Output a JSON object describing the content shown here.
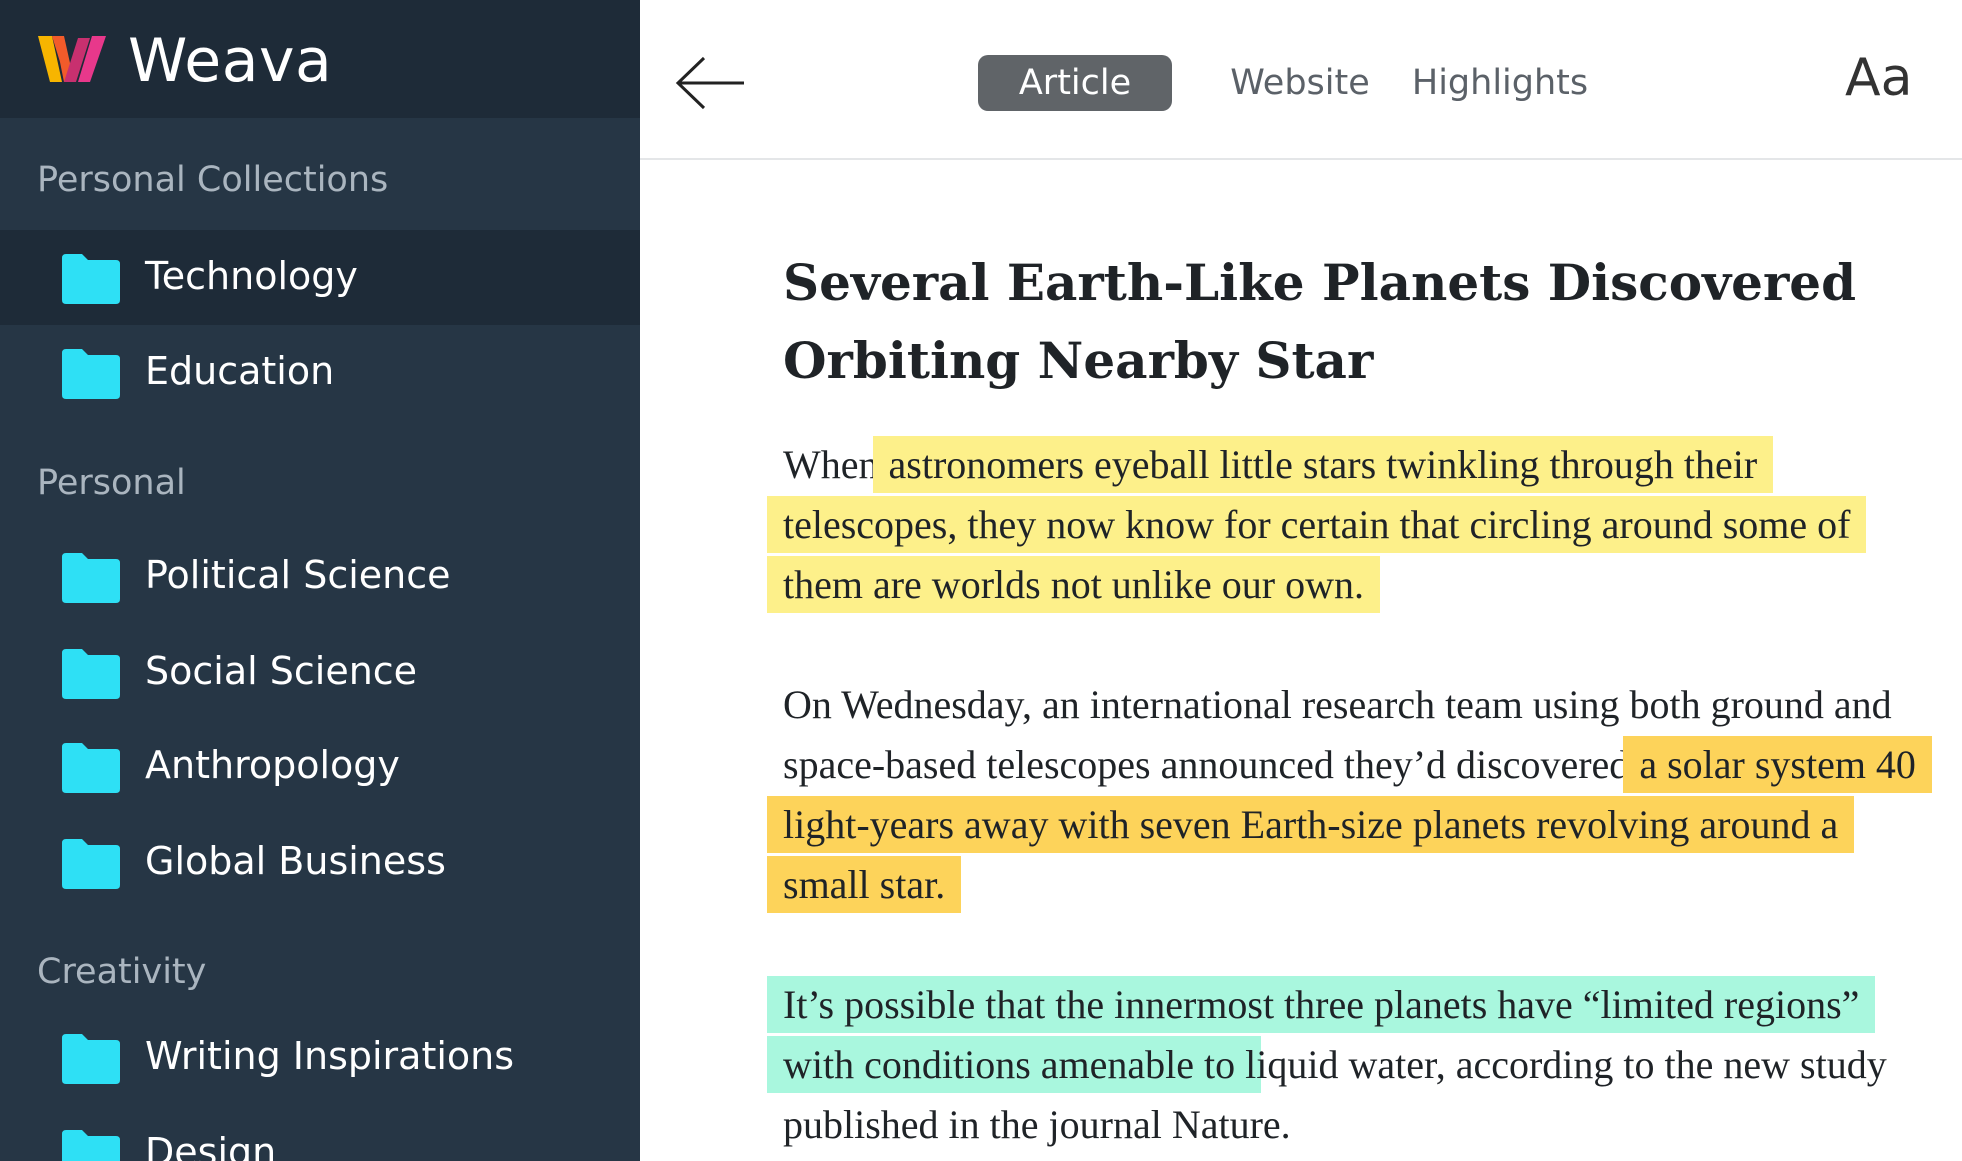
{
  "app": {
    "name": "Weava"
  },
  "sidebar": {
    "sections": [
      {
        "title": "Personal Collections",
        "items": [
          {
            "label": "Technology"
          },
          {
            "label": "Education"
          }
        ]
      },
      {
        "title": "Personal",
        "items": [
          {
            "label": "Political Science"
          },
          {
            "label": "Social Science"
          },
          {
            "label": "Anthropology"
          },
          {
            "label": "Global Business"
          }
        ]
      },
      {
        "title": "Creativity",
        "items": [
          {
            "label": "Writing Inspirations"
          },
          {
            "label": "Design"
          }
        ]
      }
    ],
    "active_item": "Technology"
  },
  "toolbar": {
    "tabs": [
      {
        "label": "Article"
      },
      {
        "label": "Website"
      },
      {
        "label": "Highlights"
      }
    ],
    "active_tab": "Article",
    "font_button": "Aa"
  },
  "article": {
    "title": "Several Earth-Like Planets Discovered Orbiting Nearby Star",
    "p1": {
      "before": "When ",
      "highlight": "astronomers eyeball little stars twinkling through their telescopes, they now know for certain that circling around some of them are worlds not unlike our own."
    },
    "p2": {
      "before": "On Wednesday, an international research team using both ground and space-based telescopes announced they’d discovered ",
      "highlight": "a solar system 40 light-years away with seven Earth-size planets revolving around a small star."
    },
    "p3": {
      "highlight": "It’s possible that the innermost three planets have “limited regions” with conditions amenable to ",
      "after": "liquid water, according to the new study published in the journal Nature."
    }
  },
  "colors": {
    "sidebar_bg": "#263645",
    "sidebar_header_bg": "#1e2b38",
    "folder": "#2ee0f5",
    "highlight_yellow": "#fdf08a",
    "highlight_orange": "#fdd35a",
    "highlight_mint": "#a9f7de"
  }
}
